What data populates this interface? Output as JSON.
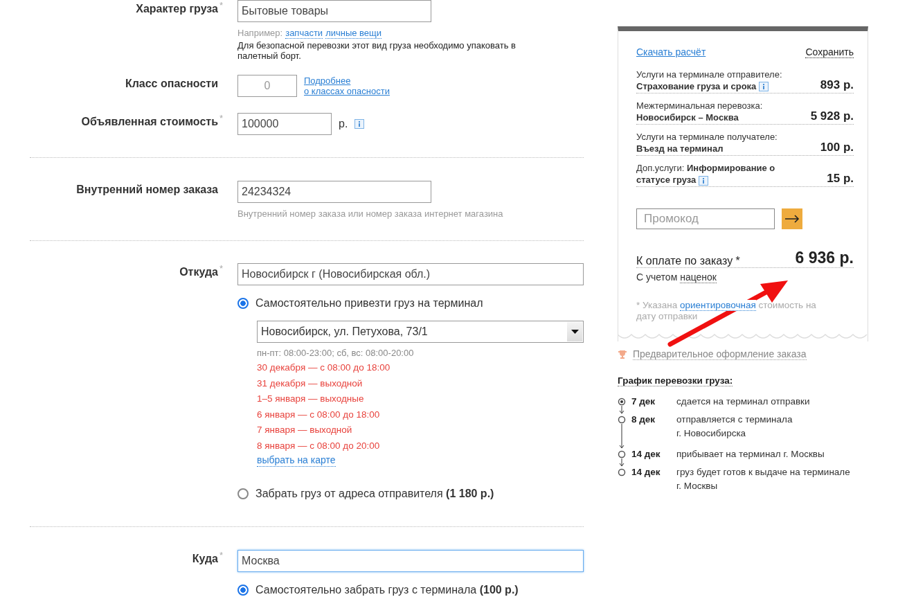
{
  "cargo_type": {
    "label": "Характер груза",
    "required_mark": "*",
    "value": "Бытовые товары",
    "hint_prefix": "Например:",
    "hint_links": [
      "запчасти",
      "личные вещи"
    ],
    "note": "Для безопасной перевозки этот вид груза необходимо упаковать в палетный борт."
  },
  "hazard_class": {
    "label": "Класс опасности",
    "placeholder": "0",
    "link_lines": [
      "Подробнее",
      "о классах опасности"
    ]
  },
  "declared_value": {
    "label": "Объявленная стоимость",
    "required_mark": "*",
    "value": "100000",
    "unit": "р.",
    "info": true
  },
  "order_number": {
    "label": "Внутренний номер заказа",
    "value": "24234324",
    "hint": "Внутренний номер заказа или номер заказа интернет магазина"
  },
  "from": {
    "label": "Откуда",
    "required_mark": "*",
    "value": "Новосибирск г (Новосибирская обл.)",
    "focused": false,
    "options": [
      {
        "label": "Самостоятельно привезти груз на терминал",
        "selected": true,
        "terminal": {
          "value": "Новосибирск, ул. Петухова, 73/1",
          "hours": "пн-пт: 08:00-23:00; сб, вс: 08:00-20:00",
          "schedule": [
            "30 декабря — с 08:00 до 18:00",
            "31 декабря — выходной",
            "1–5 января — выходные",
            "6 января — с 08:00 до 18:00",
            "7 января — выходной",
            "8 января — с 08:00 до 20:00"
          ],
          "map_link": "выбрать на карте"
        }
      },
      {
        "label": "Забрать груз от адреса отправителя",
        "price": "(1 180 р.)",
        "selected": false
      }
    ]
  },
  "to": {
    "label": "Куда",
    "required_mark": "*",
    "value": "Москва",
    "focused": true,
    "options": [
      {
        "label": "Самостоятельно забрать груз с терминала",
        "price": "(100 р.)",
        "selected": true
      }
    ]
  },
  "summary": {
    "download_link": "Скачать расчёт",
    "save_link": "Сохранить",
    "items": [
      {
        "kind": "stacked",
        "title": "Услуги на терминале отправителе:",
        "detail": "Страхование груза и срока",
        "info": true,
        "price": "893 р."
      },
      {
        "kind": "stacked",
        "title": "Межтерминальная перевозка:",
        "detail": "Новосибирск – Москва",
        "info": false,
        "price": "5 928 р."
      },
      {
        "kind": "stacked",
        "title": "Услуги на терминале получателе:",
        "detail": "Въезд на терминал",
        "info": false,
        "price": "100 р."
      },
      {
        "kind": "inline",
        "title": "Доп.услуги:",
        "detail": "Информирование о статусе груза",
        "info": true,
        "price": "15 р."
      }
    ],
    "promo_placeholder": "Промокод",
    "total_label": "К оплате по заказу *",
    "total": "6 936 р.",
    "markup_prefix": "С учетом",
    "markup_link": "наценок",
    "note_prefix": "* Указана",
    "note_link": "ориентировочная",
    "note_suffix": "стоимость на дату отправки"
  },
  "pre_order_link": "Предварительное оформление заказа",
  "transport_schedule": {
    "title": "График перевозки груза:",
    "steps": [
      {
        "date": "7 дек",
        "text": "сдается на терминал отправки",
        "current": true
      },
      {
        "date": "8 дек",
        "text": "отправляется с терминала\nг. Новосибирска",
        "current": false
      },
      {
        "date": "14 дек",
        "text": "прибывает на терминал г. Москвы",
        "current": false
      },
      {
        "date": "14 дек",
        "text": "груз будет готов к выдаче на терминале\nг. Москвы",
        "current": false
      }
    ]
  }
}
